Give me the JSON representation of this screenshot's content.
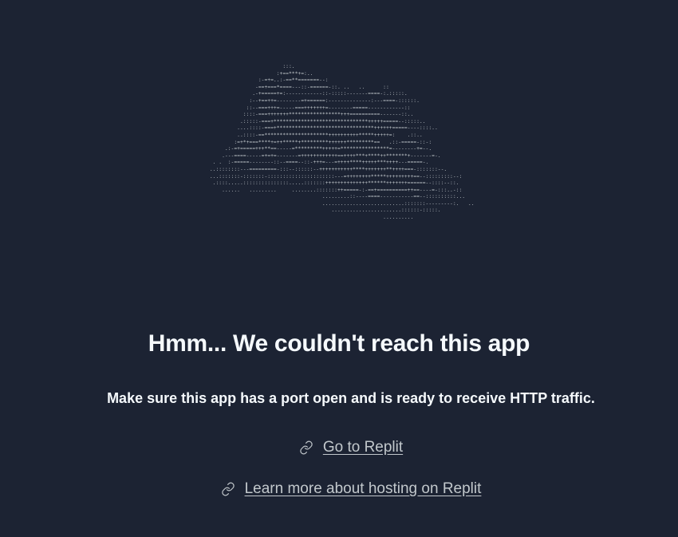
{
  "error": {
    "title": "Hmm... We couldn't reach this app",
    "message": "Make sure this app has a port open and is ready to receive HTTP traffic."
  },
  "links": {
    "replit": {
      "label": "Go to Replit",
      "icon": "link-icon"
    },
    "hosting": {
      "label": "Learn more about hosting on Replit",
      "icon": "link-icon"
    }
  },
  "colors": {
    "background": "#1c2333",
    "text": "#f5f9fc",
    "link": "#c2c8cc"
  }
}
